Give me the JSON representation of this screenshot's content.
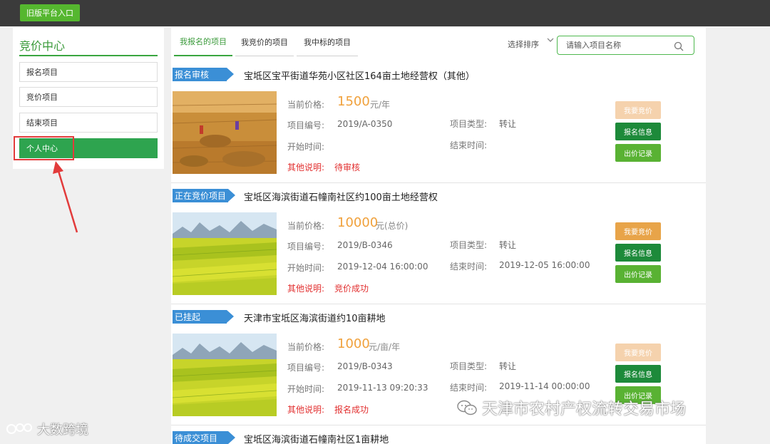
{
  "topbar": {
    "old_platform_button": "旧版平台入口"
  },
  "sidebar": {
    "title": "竞价中心",
    "items": [
      {
        "label": "报名项目",
        "active": false
      },
      {
        "label": "竞价项目",
        "active": false
      },
      {
        "label": "结束项目",
        "active": false
      },
      {
        "label": "个人中心",
        "active": true
      }
    ]
  },
  "tabs": [
    {
      "label": "我报名的项目",
      "active": true
    },
    {
      "label": "我竞价的项目",
      "active": false
    },
    {
      "label": "我中标的项目",
      "active": false
    }
  ],
  "sort": {
    "label": "选择排序"
  },
  "search": {
    "placeholder": "请输入项目名称"
  },
  "labels": {
    "price": "当前价格:",
    "code": "项目编号:",
    "type": "项目类型:",
    "start": "开始时间:",
    "end": "结束时间:",
    "note": "其他说明:",
    "bid_button": "我要竞价",
    "info_button": "报名信息",
    "record_button": "出价记录"
  },
  "projects": [
    {
      "status": "报名审核",
      "title": "宝坻区宝平街道华苑小区社区164亩土地经营权（其他）",
      "price": "1500",
      "unit": "元/年",
      "code": "2019/A-0350",
      "type": "转让",
      "start": "",
      "end": "",
      "note": "待审核",
      "bid_enabled": false,
      "image": "wheat-harvest"
    },
    {
      "status": "正在竞价项目",
      "title": "宝坻区海滨街道石幢南社区约100亩土地经营权",
      "price": "10000",
      "unit": "元(总价)",
      "code": "2019/B-0346",
      "type": "转让",
      "start": "2019-12-04 16:00:00",
      "end": "2019-12-05 16:00:00",
      "note": "竞价成功",
      "bid_enabled": true,
      "image": "rapeseed-field"
    },
    {
      "status": "已挂起",
      "title": "天津市宝坻区海滨街道约10亩耕地",
      "price": "1000",
      "unit": "元/亩/年",
      "code": "2019/B-0343",
      "type": "转让",
      "start": "2019-11-13 09:20:33",
      "end": "2019-11-14 00:00:00",
      "note": "报名成功",
      "bid_enabled": false,
      "image": "rapeseed-field"
    },
    {
      "status": "待成交项目",
      "title": "宝坻区海滨街道石幢南社区1亩耕地"
    }
  ],
  "watermarks": {
    "account": "天津市农村产权流转交易市场",
    "brand": "大数跨境"
  },
  "colors": {
    "topbar": "#3b3b3b",
    "accent_green": "#3aa640",
    "status_blue": "#3b8fd6",
    "price_orange": "#f0a13c",
    "note_red": "#e23030",
    "highlight_red": "#e23b3b"
  }
}
